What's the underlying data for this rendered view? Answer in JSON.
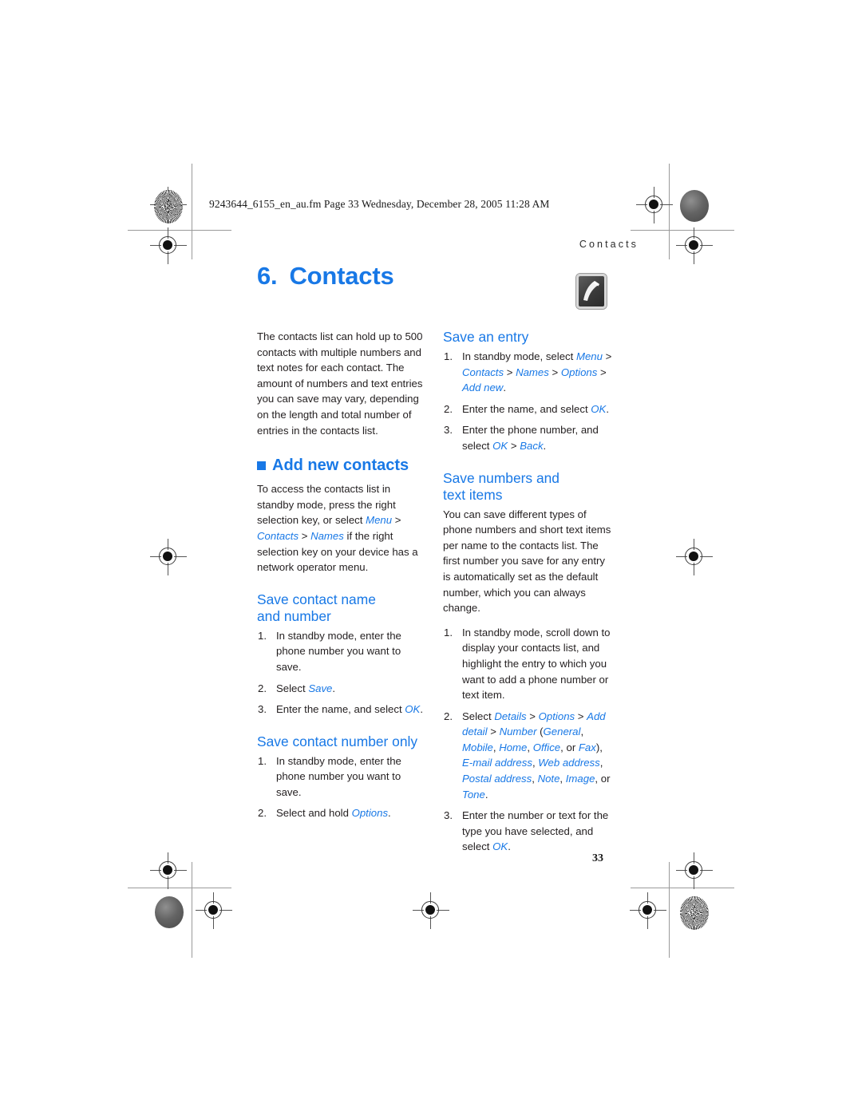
{
  "print_marks": {
    "slugline": "9243644_6155_en_au.fm  Page 33  Wednesday, December 28, 2005  11:28 AM",
    "running_head": "Contacts",
    "folio": "33"
  },
  "chapter": {
    "number": "6.",
    "title": "Contacts",
    "icon": "contacts-card-icon",
    "accent_color": "#1878e6",
    "text_color": "#231f20"
  },
  "left_column": {
    "intro": "The contacts list can hold up to 500 contacts with multiple numbers and text notes for each contact. The amount of numbers and text entries you can save may vary, depending on the length and total number of entries in the contacts list.",
    "section_add_new": {
      "heading": "Add new contacts",
      "paragraph_part1": "To access the contacts list in standby mode, press the right selection key, or select ",
      "ui_menu": "Menu",
      "ui_contacts": "Contacts",
      "ui_names": "Names",
      "sep": " > ",
      "paragraph_part2": " if the right selection key on your device has a network operator menu."
    },
    "section_save_name_number": {
      "heading_line1": "Save contact name",
      "heading_line2": "and number",
      "step1": "In standby mode, enter the phone number you want to save.",
      "step2_pre": "Select ",
      "step2_ui": "Save",
      "step2_post": ".",
      "step3_pre": "Enter the name, and select ",
      "step3_ui": "OK",
      "step3_post": "."
    },
    "section_save_number_only": {
      "heading": "Save contact number only",
      "step1": "In standby mode, enter the phone number you want to save.",
      "step2_pre": "Select and hold ",
      "step2_ui": "Options",
      "step2_post": "."
    }
  },
  "right_column": {
    "section_save_entry": {
      "heading": "Save an entry",
      "step1_pre": "In standby mode, select ",
      "step1_ui": [
        "Menu",
        "Contacts",
        "Names",
        "Options",
        "Add new"
      ],
      "step1_post": ".",
      "step2_pre": "Enter the name, and select ",
      "step2_ui": "OK",
      "step2_post": ".",
      "step3_pre": "Enter the phone number, and select ",
      "step3_ui_a": "OK",
      "step3_ui_b": "Back",
      "step3_post": "."
    },
    "section_save_numbers_text": {
      "heading_line1": "Save numbers and",
      "heading_line2": "text items",
      "paragraph": "You can save different types of phone numbers and short text items per name to the contacts list. The first number you save for any entry is automatically set as the default number, which you can always change.",
      "step1": "In standby mode, scroll down to display your contacts list, and highlight the entry to which you want to add a phone number or text item.",
      "step2_pre": "Select ",
      "step2_details": "Details",
      "step2_options": "Options",
      "step2_adddetail": "Add detail",
      "step2_number": "Number",
      "step2_open_paren": " (",
      "step2_general": "General",
      "step2_mobile": "Mobile",
      "step2_home": "Home",
      "step2_office": "Office",
      "step2_or1": ", or ",
      "step2_fax": "Fax",
      "step2_close_paren": "), ",
      "step2_email": "E-mail address",
      "step2_web": "Web address",
      "step2_postal": "Postal address",
      "step2_note": "Note",
      "step2_image": "Image",
      "step2_or2": ", or ",
      "step2_tone": "Tone",
      "step2_post": ".",
      "step3_pre": "Enter the number or text for the type you have selected, and select ",
      "step3_ui": "OK",
      "step3_post": "."
    }
  }
}
